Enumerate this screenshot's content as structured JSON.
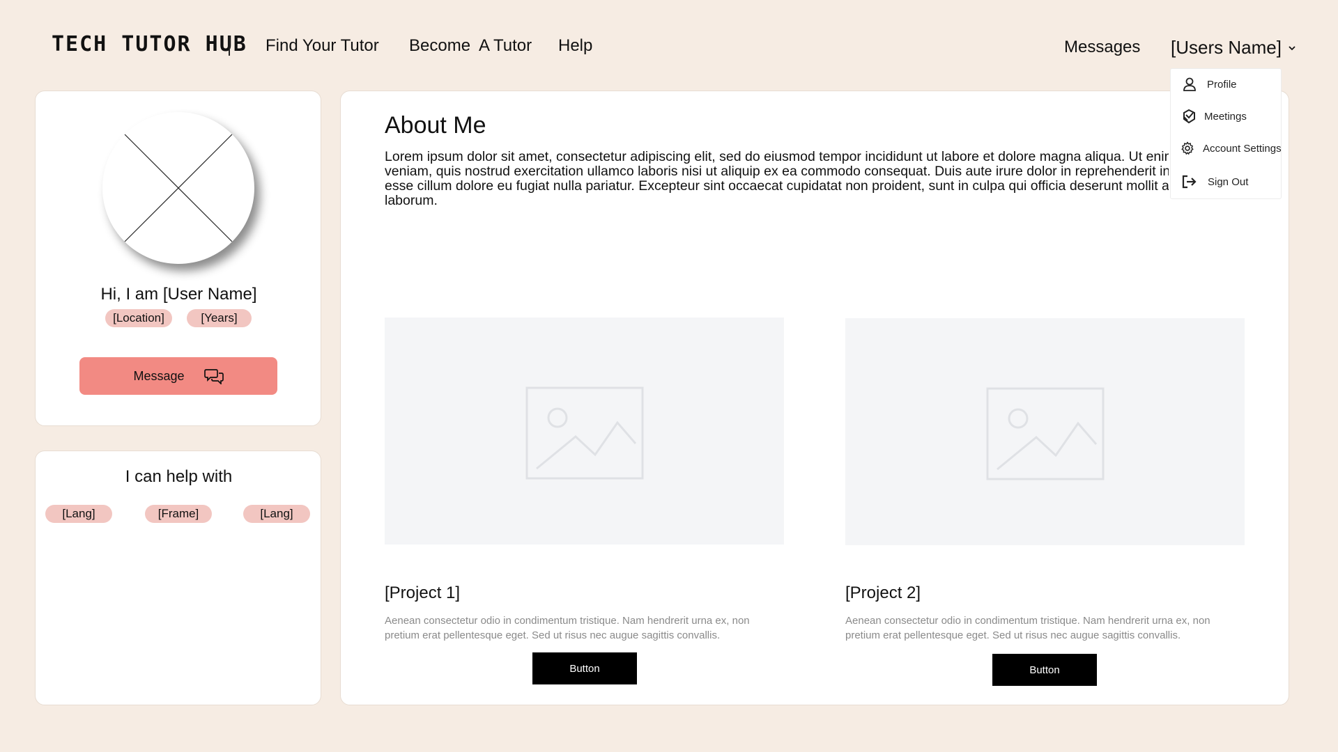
{
  "brand": {
    "logo": "TECH TUTOR HUB"
  },
  "nav": {
    "links": [
      "Find Your Tutor",
      "Become  A Tutor",
      "Help"
    ],
    "messages": "Messages",
    "user": "[Users Name]"
  },
  "dropdown": {
    "items": [
      {
        "label": "Profile",
        "icon": "user-icon"
      },
      {
        "label": "Meetings",
        "icon": "meetings-icon"
      },
      {
        "label": "Account Settings",
        "icon": "gear-icon"
      },
      {
        "label": "Sign Out",
        "icon": "sign-out-icon"
      }
    ]
  },
  "profile": {
    "greeting": "Hi, I am [User Name]",
    "tags": [
      "[Location]",
      "[Years]"
    ],
    "message_button": "Message"
  },
  "help": {
    "title": "I can help with",
    "tags": [
      "[Lang]",
      "[Frame]",
      "[Lang]"
    ]
  },
  "about": {
    "title": "About Me",
    "text": "Lorem ipsum dolor sit amet, consectetur adipiscing elit, sed do eiusmod tempor incididunt ut labore et dolore magna aliqua. Ut enim ad minim veniam, quis nostrud exercitation ullamco laboris nisi ut aliquip ex ea commodo consequat. Duis aute irure dolor in reprehenderit in voluptate velit esse cillum dolore eu fugiat nulla pariatur. Excepteur sint occaecat cupidatat non proident, sunt in culpa qui officia deserunt mollit anim id est laborum."
  },
  "projects": [
    {
      "title": "[Project 1]",
      "description": "Aenean consectetur odio in condimentum tristique. Nam hendrerit urna ex, non pretium erat pellentesque eget. Sed ut risus nec augue sagittis convallis.",
      "button": "Button"
    },
    {
      "title": "[Project 2]",
      "description": "Aenean consectetur odio in condimentum tristique. Nam hendrerit urna ex, non pretium erat pellentesque eget. Sed ut risus nec augue sagittis convallis.",
      "button": "Button"
    }
  ],
  "colors": {
    "background": "#f6ece3",
    "accent": "#f28a83",
    "tag": "#f2c6c1"
  }
}
